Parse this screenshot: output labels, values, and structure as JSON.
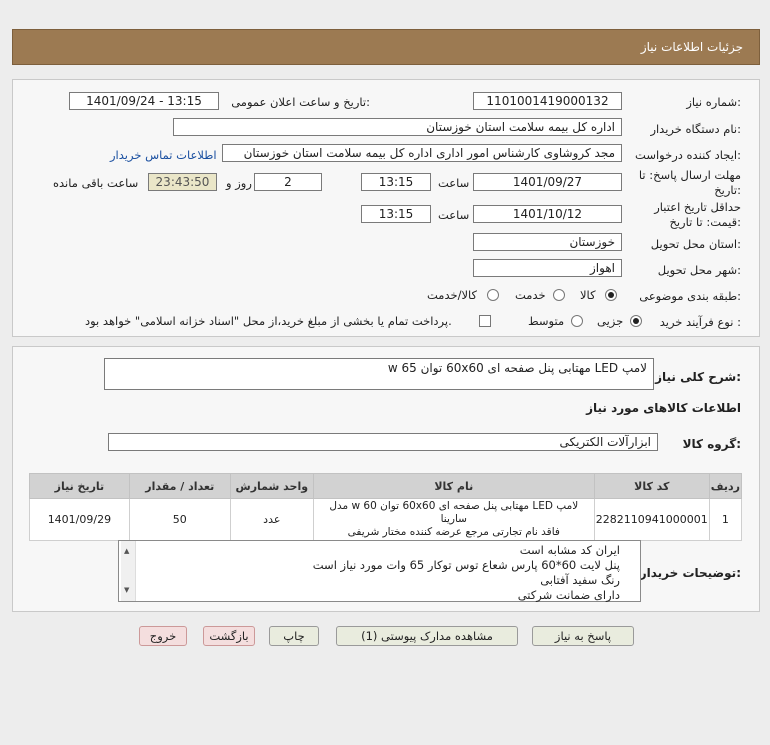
{
  "header": {
    "title": "جزئیات اطلاعات نیاز"
  },
  "form": {
    "need_number_label": "شماره نیاز:",
    "need_number": "1101001419000132",
    "announce_label": "تاریخ و ساعت اعلان عمومی:",
    "announce_value": "1401/09/24 - 13:15",
    "buyer_org_label": "نام دستگاه خریدار:",
    "buyer_org": "اداره کل بیمه سلامت استان خوزستان",
    "creator_label": "ایجاد کننده درخواست:",
    "creator": "مجد کروشاوی کارشناس امور اداری اداره کل بیمه سلامت استان خوزستان",
    "contact_link": "اطلاعات تماس خریدار",
    "deadline_label_1": "مهلت ارسال پاسخ: تا",
    "deadline_label_2": "تاریخ:",
    "deadline_date": "1401/09/27",
    "time_label": "ساعت",
    "deadline_time": "13:15",
    "days_value": "2",
    "days_label": "روز و",
    "remaining_time": "23:43:50",
    "remaining_label": "ساعت باقی مانده",
    "validity_label_1": "حداقل تاریخ اعتبار",
    "validity_label_2": "قیمت: تا تاریخ:",
    "validity_date": "1401/10/12",
    "validity_time_label": "ساعت",
    "validity_time": "13:15",
    "province_label": "استان محل تحویل:",
    "province": "خوزستان",
    "city_label": "شهر محل تحویل:",
    "city": "اهواز",
    "category_label": "طبقه بندی موضوعی:",
    "category_options": [
      "کالا",
      "خدمت",
      "کالا/خدمت"
    ],
    "purchase_label": "نوع فرآیند خرید :",
    "purchase_options": [
      "جزیی",
      "متوسط"
    ],
    "payment_note": "پرداخت تمام یا بخشی از مبلغ خرید،از محل \"اسناد خزانه اسلامی\" خواهد بود."
  },
  "summary": {
    "title_label": "شرح کلی نیاز:",
    "title_value": "لامپ LED مهتابی پنل صفحه ای 60x60 توان 65 w",
    "goods_info_label": "اطلاعات کالاهای مورد نیاز",
    "group_label": "گروه کالا:",
    "group_value": "ابزارآلات الکتریکی"
  },
  "table": {
    "headers": [
      "ردیف",
      "کد کالا",
      "نام کالا",
      "واحد شمارش",
      "تعداد / مقدار",
      "تاریخ نیاز"
    ],
    "rows": [
      {
        "row": "1",
        "code": "2282110941000001",
        "name_line1": "لامپ LED مهتابی پنل صفحه ای 60x60 توان 60 w مدل سارینا",
        "name_line2": "فاقد نام تجارتی مرجع عرضه کننده مختار شریفی",
        "unit": "عدد",
        "qty": "50",
        "date": "1401/09/29"
      }
    ]
  },
  "buyer_notes": {
    "label": "توضیحات خریدار:",
    "lines": [
      "ایران کد مشابه است",
      "پنل لایت 60*60 پارس شعاع توس توکار 65 وات مورد نیاز است",
      "رنگ سفید آفتابی",
      "دارای ضمانت شرکتی"
    ]
  },
  "buttons": {
    "reply": "پاسخ به نیاز",
    "attachments": "مشاهده مدارک پیوستی (1)",
    "print": "چاپ",
    "back": "بازگشت",
    "exit": "خروج"
  },
  "colors": {
    "header_bg": "#9c7a52",
    "link": "#1a4fa0",
    "remaining_bg": "#eae6c8"
  }
}
